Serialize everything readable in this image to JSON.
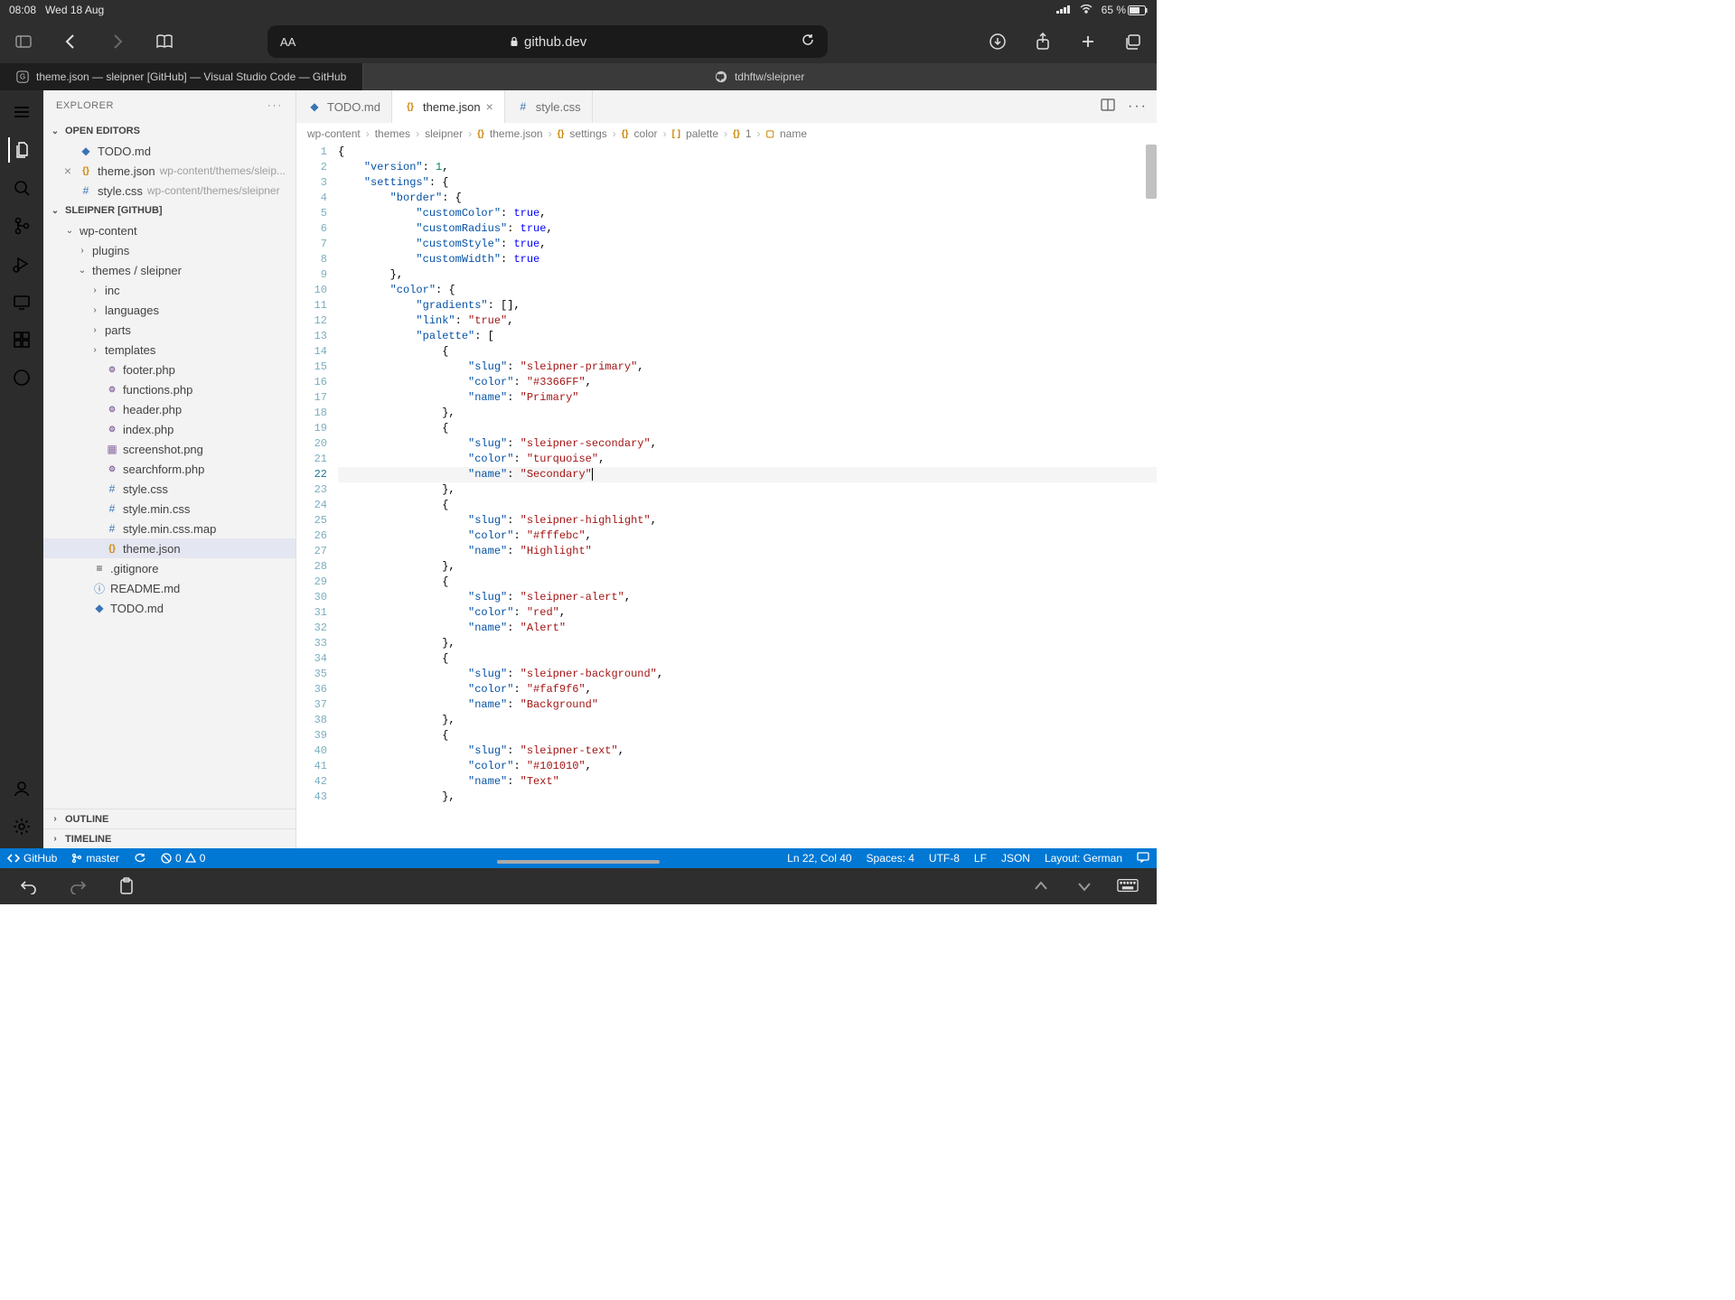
{
  "status_bar": {
    "time": "08:08",
    "date": "Wed 18 Aug",
    "battery": "65 %"
  },
  "safari": {
    "url_host": "github.dev"
  },
  "browser_tabs": {
    "active": "theme.json — sleipner [GitHub] — Visual Studio Code — GitHub",
    "inactive": "tdhftw/sleipner"
  },
  "sidebar": {
    "title": "EXPLORER",
    "open_editors": {
      "label": "OPEN EDITORS",
      "items": [
        {
          "name": "TODO.md",
          "path": ""
        },
        {
          "name": "theme.json",
          "path": "wp-content/themes/sleip..."
        },
        {
          "name": "style.css",
          "path": "wp-content/themes/sleipner"
        }
      ]
    },
    "repo_header": "SLEIPNER [GITHUB]",
    "tree": [
      {
        "name": "wp-content",
        "type": "folder",
        "indent": 1,
        "expanded": true
      },
      {
        "name": "plugins",
        "type": "folder",
        "indent": 2,
        "expanded": false
      },
      {
        "name": "themes / sleipner",
        "type": "folder",
        "indent": 2,
        "expanded": true
      },
      {
        "name": "inc",
        "type": "folder",
        "indent": 3,
        "expanded": false
      },
      {
        "name": "languages",
        "type": "folder",
        "indent": 3,
        "expanded": false
      },
      {
        "name": "parts",
        "type": "folder",
        "indent": 3,
        "expanded": false
      },
      {
        "name": "templates",
        "type": "folder",
        "indent": 3,
        "expanded": false
      },
      {
        "name": "footer.php",
        "type": "php",
        "indent": 3
      },
      {
        "name": "functions.php",
        "type": "php",
        "indent": 3
      },
      {
        "name": "header.php",
        "type": "php",
        "indent": 3
      },
      {
        "name": "index.php",
        "type": "php",
        "indent": 3
      },
      {
        "name": "screenshot.png",
        "type": "img",
        "indent": 3
      },
      {
        "name": "searchform.php",
        "type": "php",
        "indent": 3
      },
      {
        "name": "style.css",
        "type": "css",
        "indent": 3
      },
      {
        "name": "style.min.css",
        "type": "css",
        "indent": 3
      },
      {
        "name": "style.min.css.map",
        "type": "css",
        "indent": 3
      },
      {
        "name": "theme.json",
        "type": "json",
        "indent": 3,
        "selected": true
      },
      {
        "name": ".gitignore",
        "type": "txt",
        "indent": 2
      },
      {
        "name": "README.md",
        "type": "info",
        "indent": 2
      },
      {
        "name": "TODO.md",
        "type": "md",
        "indent": 2
      }
    ],
    "outline": "OUTLINE",
    "timeline": "TIMELINE"
  },
  "tabs": [
    {
      "label": "TODO.md",
      "icon": "md"
    },
    {
      "label": "theme.json",
      "icon": "json",
      "active": true
    },
    {
      "label": "style.css",
      "icon": "css"
    }
  ],
  "breadcrumbs": [
    "wp-content",
    "themes",
    "sleipner",
    "theme.json",
    "settings",
    "color",
    "palette",
    "1",
    "name"
  ],
  "code_lines": [
    {
      "n": 1,
      "t": "{"
    },
    {
      "n": 2,
      "t": "    \"version\": 1,"
    },
    {
      "n": 3,
      "t": "    \"settings\": {"
    },
    {
      "n": 4,
      "t": "        \"border\": {"
    },
    {
      "n": 5,
      "t": "            \"customColor\": true,"
    },
    {
      "n": 6,
      "t": "            \"customRadius\": true,"
    },
    {
      "n": 7,
      "t": "            \"customStyle\": true,"
    },
    {
      "n": 8,
      "t": "            \"customWidth\": true"
    },
    {
      "n": 9,
      "t": "        },"
    },
    {
      "n": 10,
      "t": "        \"color\": {"
    },
    {
      "n": 11,
      "t": "            \"gradients\": [],  "
    },
    {
      "n": 12,
      "t": "            \"link\": \"true\","
    },
    {
      "n": 13,
      "t": "            \"palette\": ["
    },
    {
      "n": 14,
      "t": "                {"
    },
    {
      "n": 15,
      "t": "                    \"slug\": \"sleipner-primary\","
    },
    {
      "n": 16,
      "t": "                    \"color\": \"#3366FF\","
    },
    {
      "n": 17,
      "t": "                    \"name\": \"Primary\""
    },
    {
      "n": 18,
      "t": "                },"
    },
    {
      "n": 19,
      "t": "                {"
    },
    {
      "n": 20,
      "t": "                    \"slug\": \"sleipner-secondary\","
    },
    {
      "n": 21,
      "t": "                    \"color\": \"turquoise\","
    },
    {
      "n": 22,
      "t": "                    \"name\": \"Secondary\"",
      "active": true
    },
    {
      "n": 23,
      "t": "                },"
    },
    {
      "n": 24,
      "t": "                {"
    },
    {
      "n": 25,
      "t": "                    \"slug\": \"sleipner-highlight\","
    },
    {
      "n": 26,
      "t": "                    \"color\": \"#fffebc\","
    },
    {
      "n": 27,
      "t": "                    \"name\": \"Highlight\""
    },
    {
      "n": 28,
      "t": "                },"
    },
    {
      "n": 29,
      "t": "                {"
    },
    {
      "n": 30,
      "t": "                    \"slug\": \"sleipner-alert\","
    },
    {
      "n": 31,
      "t": "                    \"color\": \"red\","
    },
    {
      "n": 32,
      "t": "                    \"name\": \"Alert\""
    },
    {
      "n": 33,
      "t": "                },"
    },
    {
      "n": 34,
      "t": "                {"
    },
    {
      "n": 35,
      "t": "                    \"slug\": \"sleipner-background\","
    },
    {
      "n": 36,
      "t": "                    \"color\": \"#faf9f6\","
    },
    {
      "n": 37,
      "t": "                    \"name\": \"Background\""
    },
    {
      "n": 38,
      "t": "                },"
    },
    {
      "n": 39,
      "t": "                {"
    },
    {
      "n": 40,
      "t": "                    \"slug\": \"sleipner-text\","
    },
    {
      "n": 41,
      "t": "                    \"color\": \"#101010\","
    },
    {
      "n": 42,
      "t": "                    \"name\": \"Text\""
    },
    {
      "n": 43,
      "t": "                },"
    }
  ],
  "status_line": {
    "github": "GitHub",
    "branch": "master",
    "errors": "0",
    "warnings": "0",
    "cursor": "Ln 22, Col 40",
    "spaces": "Spaces: 4",
    "encoding": "UTF-8",
    "eol": "LF",
    "lang": "JSON",
    "layout": "Layout: German"
  }
}
